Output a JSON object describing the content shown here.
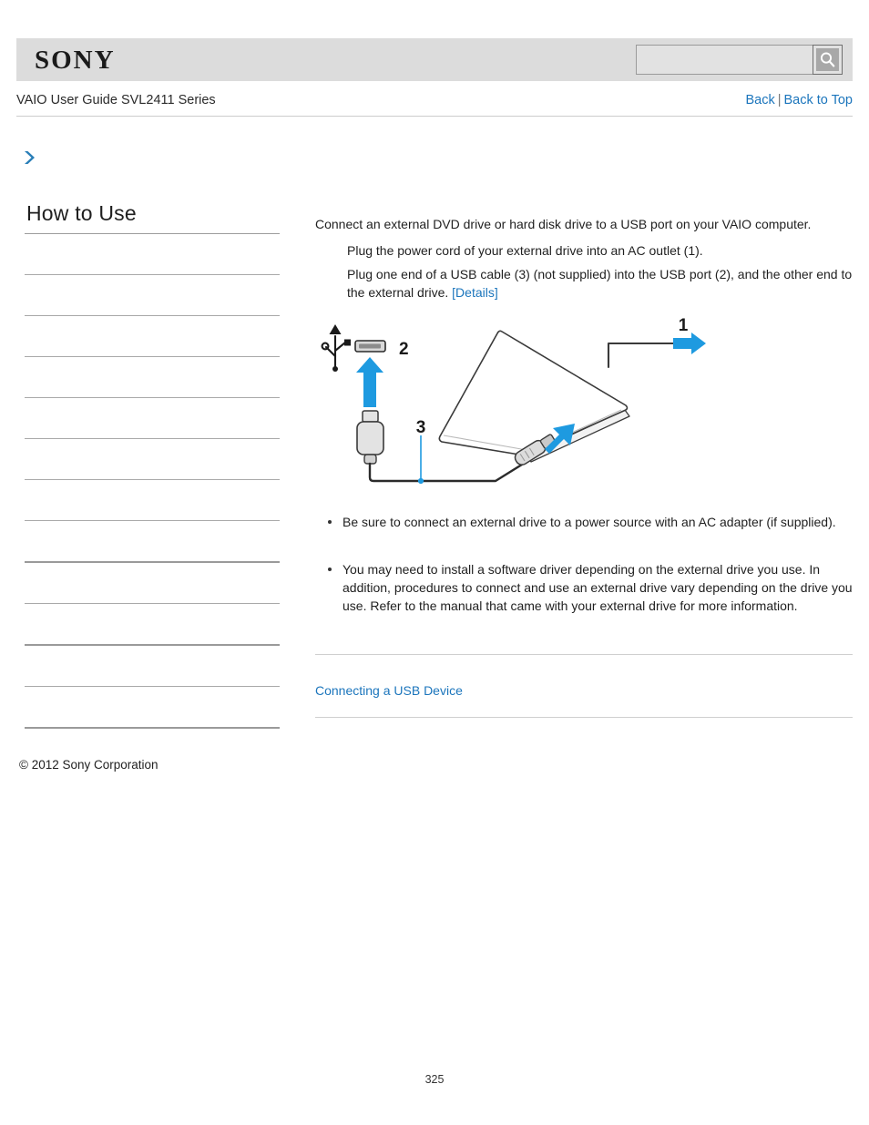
{
  "header": {
    "logo_text": "SONY",
    "search": {
      "value": "",
      "placeholder": "",
      "icon": "search-icon"
    }
  },
  "titlebar": {
    "guide_title": "VAIO User Guide SVL2411 Series",
    "back_label": "Back",
    "separator": "|",
    "back_to_top_label": "Back to Top"
  },
  "breadcrumb": {
    "icon": "chevron-right-icon",
    "text": ""
  },
  "sidebar": {
    "title": "How to Use",
    "items": [
      {
        "label": ""
      },
      {
        "label": ""
      },
      {
        "label": ""
      },
      {
        "label": ""
      },
      {
        "label": ""
      },
      {
        "label": ""
      },
      {
        "label": ""
      },
      {
        "label": ""
      },
      {
        "label": ""
      },
      {
        "label": ""
      },
      {
        "label": ""
      },
      {
        "label": ""
      }
    ]
  },
  "main": {
    "lead": "Connect an external DVD drive or hard disk drive to a USB port on your VAIO computer.",
    "steps": [
      {
        "text": "Plug the power cord of your external drive into an AC outlet (1)."
      }
    ],
    "step2_before": "Plug one end of a USB cable (3) (not supplied) into the USB port (2), and the other end to the external drive. ",
    "step2_link": "[Details]",
    "figure": {
      "alt": "External drive connected to a USB port with a USB cable and power cord",
      "callouts": [
        {
          "id": "1",
          "meaning": "AC outlet / power cord"
        },
        {
          "id": "2",
          "meaning": "USB port"
        },
        {
          "id": "3",
          "meaning": "USB cable"
        }
      ],
      "accent_color": "#1e9ae0",
      "line_color": "#3a3a3a"
    },
    "notes": [
      {
        "text": "Be sure to connect an external drive to a power source with an AC adapter (if supplied)."
      },
      {
        "text": "You may need to install a software driver depending on the external drive you use. In addition, procedures to connect and use an external drive vary depending on the drive you use. Refer to the manual that came with your external drive for more information."
      }
    ],
    "related_link": "Connecting a USB Device"
  },
  "footer": {
    "copyright": "© 2012 Sony Corporation",
    "page_number": "325"
  },
  "colors": {
    "link": "#1b75bc",
    "accent": "#1e9ae0",
    "header_bg": "#dcdcdc"
  }
}
